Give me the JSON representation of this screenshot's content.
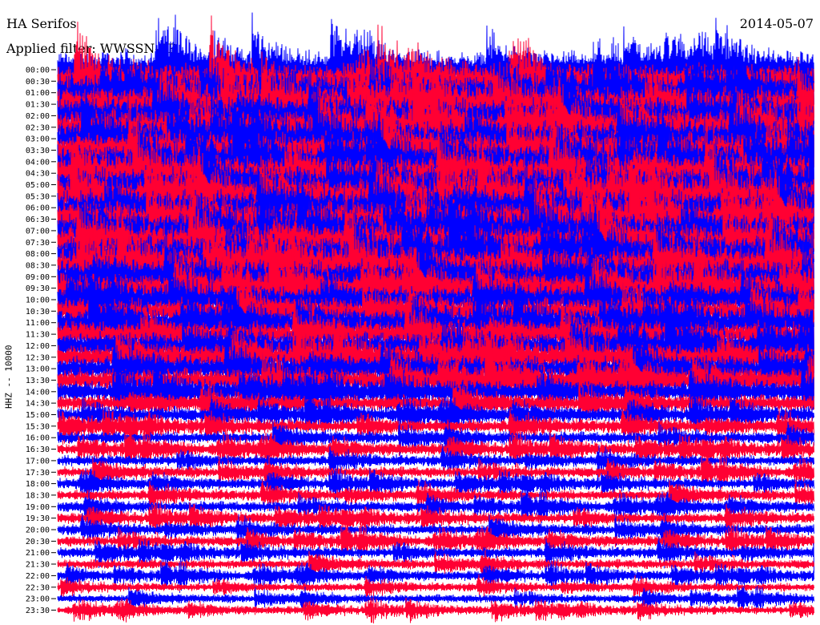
{
  "header": {
    "station": "HA Serifos",
    "date": "2014-05-07",
    "filter": "Applied filter: WWSSN-SP"
  },
  "chart_data": {
    "type": "line",
    "ylabel": "HHZ -- 10000",
    "rows": [
      "00:00",
      "00:30",
      "01:00",
      "01:30",
      "02:00",
      "02:30",
      "03:00",
      "03:30",
      "04:00",
      "04:30",
      "05:00",
      "05:30",
      "06:00",
      "06:30",
      "07:00",
      "07:30",
      "08:00",
      "08:30",
      "09:00",
      "09:30",
      "10:00",
      "10:30",
      "11:00",
      "11:30",
      "12:00",
      "12:30",
      "13:00",
      "13:30",
      "14:00",
      "14:30",
      "15:00",
      "15:30",
      "16:00",
      "16:30",
      "17:00",
      "17:30",
      "18:00",
      "18:30",
      "19:00",
      "19:30",
      "20:00",
      "20:30",
      "21:00",
      "21:30",
      "22:00",
      "22:30",
      "23:00",
      "23:30"
    ],
    "tick_labels": [
      "00:00",
      "00:30",
      "01:00",
      "01:30",
      "02:00",
      "02:30",
      "03:00",
      "03:30",
      "04:00",
      "04:30",
      "05:00",
      "05:30",
      "06:00",
      "06:30",
      "07:00",
      "07:30",
      "08:00",
      "08:30",
      "09:00",
      "09:30",
      "10:00",
      "10:30",
      "11:00",
      "11:30",
      "12:00",
      "12:30",
      "13:00",
      "13:30",
      "14:00",
      "14:30",
      "15:00",
      "15:30",
      "16:00",
      "16:30",
      "17:00",
      "17:30",
      "18:00",
      "18:30",
      "19:00",
      "19:30",
      "20:00",
      "20:30",
      "21:00",
      "21:30",
      "22:00",
      "22:30",
      "23:00",
      "23:30"
    ],
    "amplitude": [
      3.0,
      3.0,
      3.0,
      3.0,
      3.0,
      3.0,
      3.0,
      3.0,
      3.0,
      3.0,
      3.0,
      3.0,
      3.0,
      3.0,
      3.0,
      3.0,
      3.0,
      3.0,
      2.8,
      2.5,
      2.3,
      2.2,
      2.2,
      2.2,
      2.2,
      2.2,
      2.1,
      2.0,
      1.8,
      1.4,
      1.2,
      1.1,
      1.0,
      1.0,
      0.9,
      0.9,
      0.9,
      0.9,
      0.9,
      0.9,
      0.9,
      0.9,
      0.9,
      0.8,
      0.8,
      0.7,
      0.7,
      0.7
    ],
    "colors": [
      "#0000ff",
      "#ff0033"
    ],
    "series_colors_cycle": "alternating"
  }
}
